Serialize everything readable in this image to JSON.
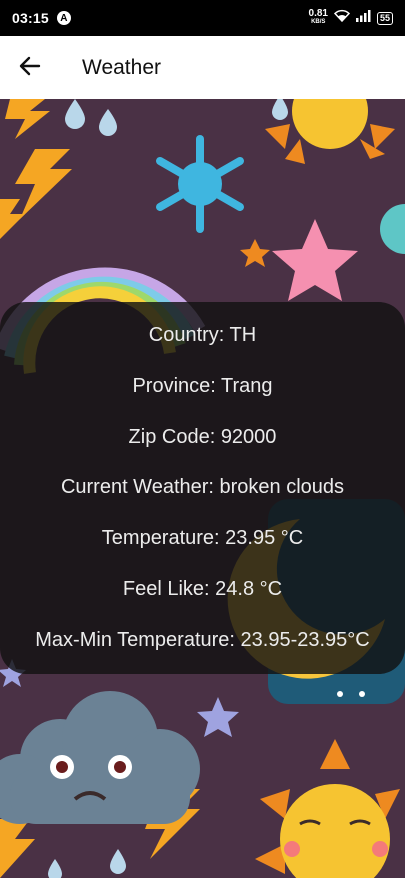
{
  "status_bar": {
    "time": "03:15",
    "app_icon": "A",
    "net_speed_value": "0.81",
    "net_speed_unit": "KB/S",
    "battery": "55"
  },
  "app_bar": {
    "back_icon": "arrow-left-icon",
    "title": "Weather"
  },
  "weather": {
    "country": "Country: TH",
    "province": "Province: Trang",
    "zip": "Zip Code: 92000",
    "current": "Current Weather: broken clouds",
    "temperature": "Temperature: 23.95 °C",
    "feel_like": "Feel Like: 24.8 °C",
    "max_min": "Max-Min Temperature: 23.95-23.95°C"
  },
  "colors": {
    "background": "#4a3145",
    "card": "#121212",
    "sun": "#f6c431",
    "sun_ray": "#ee8a20",
    "cloud": "#6b8295",
    "snowflake": "#3fb6e0",
    "star": "#f590b0",
    "lightning": "#f5a623",
    "moon": "#f7c53c",
    "night": "#1f5b78"
  }
}
